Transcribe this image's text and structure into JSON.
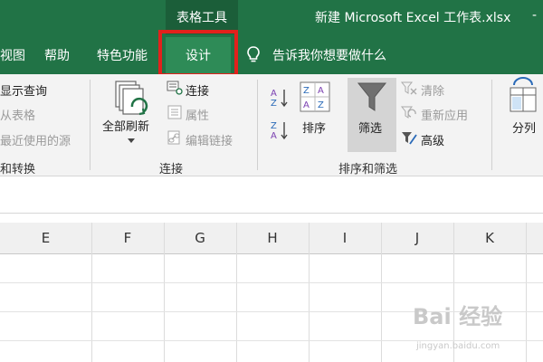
{
  "titlebar": {
    "context_group": "表格工具",
    "doc_title": "新建 Microsoft Excel 工作表.xlsx",
    "trailing": "-"
  },
  "tabs": {
    "view": "视图",
    "help": "帮助",
    "features": "特色功能",
    "design": "设计",
    "tell_me": "告诉我你想要做什么"
  },
  "ribbon": {
    "get_transform": {
      "show_query": "显示查询",
      "from_table": "从表格",
      "recent_sources": "最近使用的源",
      "group_label": "和转换"
    },
    "connections": {
      "refresh_all": "全部刷新",
      "connections": "连接",
      "properties": "属性",
      "edit_links": "编辑链接",
      "group_label": "连接"
    },
    "sort_filter": {
      "sort": "排序",
      "filter": "筛选",
      "clear": "清除",
      "reapply": "重新应用",
      "advanced": "高级",
      "group_label": "排序和筛选"
    },
    "data_tools": {
      "split": "分列"
    }
  },
  "grid": {
    "columns": [
      "E",
      "F",
      "G",
      "H",
      "I",
      "J",
      "K"
    ]
  },
  "watermark": {
    "text": "Bai 经验",
    "sub": "jingyan.baidu.com"
  },
  "colors": {
    "excel_green": "#217346",
    "highlight_red": "#e2211c"
  }
}
